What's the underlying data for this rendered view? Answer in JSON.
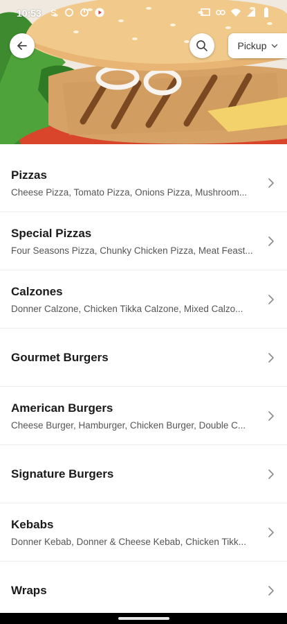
{
  "status_bar": {
    "time": "10:53",
    "icons": [
      "notification-s-icon",
      "sync-icon",
      "circle-icon",
      "play-icon",
      "cast-icon",
      "link-icon",
      "wifi-icon",
      "signal-icon",
      "battery-icon"
    ]
  },
  "header": {
    "back_icon": "arrow-left-icon",
    "search_icon": "search-icon",
    "order_mode": {
      "selected": "Pickup",
      "icon": "chevron-down-icon"
    }
  },
  "categories": [
    {
      "title": "Pizzas",
      "description": "Cheese Pizza, Tomato Pizza, Onions Pizza, Mushroom..."
    },
    {
      "title": "Special Pizzas",
      "description": "Four Seasons Pizza, Chunky Chicken Pizza, Meat Feast..."
    },
    {
      "title": "Calzones",
      "description": "Donner Calzone, Chicken Tikka Calzone, Mixed Calzo..."
    },
    {
      "title": "Gourmet Burgers",
      "description": ""
    },
    {
      "title": "American Burgers",
      "description": "Cheese Burger, Hamburger, Chicken Burger, Double C..."
    },
    {
      "title": "Signature Burgers",
      "description": ""
    },
    {
      "title": "Kebabs",
      "description": "Donner Kebab, Donner & Cheese Kebab, Chicken Tikk..."
    },
    {
      "title": "Wraps",
      "description": ""
    }
  ],
  "colors": {
    "title_text": "#1a1a1a",
    "description_text": "#555555",
    "divider": "#ececec",
    "chevron": "#8a8a8a"
  }
}
